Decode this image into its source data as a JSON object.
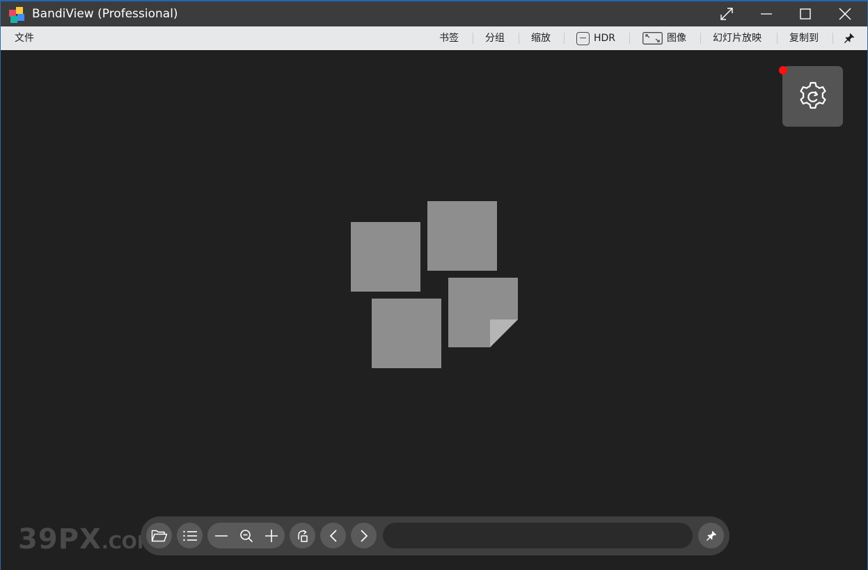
{
  "window": {
    "title": "BandiView (Professional)",
    "border_color": "#2466b0",
    "titlebar_color": "#3c3c3c"
  },
  "titlebar_buttons": [
    {
      "name": "fullscreen",
      "icon": "expand-diagonal-icon"
    },
    {
      "name": "minimize",
      "icon": "minimize-icon"
    },
    {
      "name": "maximize",
      "icon": "maximize-icon"
    },
    {
      "name": "close",
      "icon": "close-icon"
    }
  ],
  "menu": {
    "file": "文件",
    "bookmark": "书签",
    "group": "分组",
    "zoom": "缩放",
    "hdr": "HDR",
    "image": "图像",
    "slideshow": "幻灯片放映",
    "copy_to": "复制到",
    "pin_icon": "pin-icon"
  },
  "viewer": {
    "background": "#202020",
    "settings_icon": "settings-refresh-icon",
    "notification_color": "#ff1010",
    "placeholder_icon": "empty-images-icon",
    "placeholder_color": "#8e8e8e"
  },
  "watermark": {
    "big": "39PX",
    "small": ".COM"
  },
  "toolbar": {
    "open_icon": "folder-open-icon",
    "list_icon": "list-icon",
    "zoom_out_icon": "minus-icon",
    "zoom_fit_icon": "zoom-magnifier-icon",
    "zoom_in_icon": "plus-icon",
    "rotate_icon": "rotate-icon",
    "prev_icon": "chevron-left-icon",
    "next_icon": "chevron-right-icon",
    "path_value": "",
    "pin_icon": "pin-icon"
  }
}
